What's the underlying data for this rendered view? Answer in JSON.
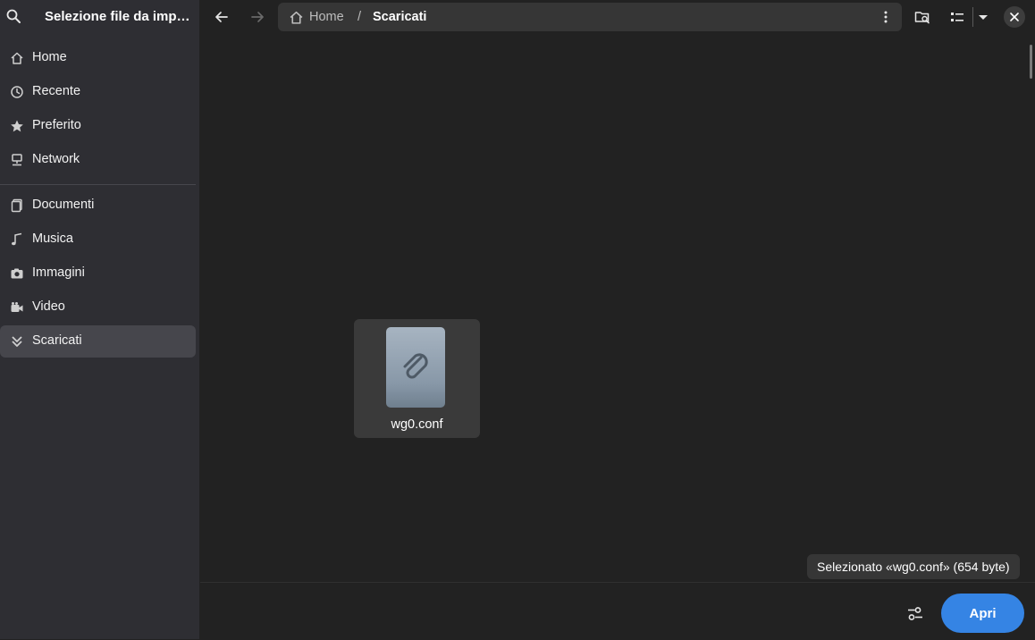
{
  "window": {
    "title": "Selezione file da imp…"
  },
  "sidebar": {
    "places": [
      {
        "label": "Home",
        "icon": "home-icon"
      },
      {
        "label": "Recente",
        "icon": "clock-icon"
      },
      {
        "label": "Preferito",
        "icon": "star-icon"
      },
      {
        "label": "Network",
        "icon": "network-icon"
      }
    ],
    "bookmarks": [
      {
        "label": "Documenti",
        "icon": "document-icon"
      },
      {
        "label": "Musica",
        "icon": "music-icon"
      },
      {
        "label": "Immagini",
        "icon": "camera-icon"
      },
      {
        "label": "Video",
        "icon": "video-icon"
      },
      {
        "label": "Scaricati",
        "icon": "download-icon",
        "selected": true
      }
    ]
  },
  "pathbar": {
    "home": "Home",
    "separator": "/",
    "current": "Scaricati"
  },
  "files": [
    {
      "name": "wg0.conf",
      "icon": "paperclip-icon",
      "selected": true
    }
  ],
  "status": {
    "text": "Selezionato «wg0.conf»  (654 byte)"
  },
  "actions": {
    "open_label": "Apri"
  },
  "colors": {
    "accent": "#3584e4",
    "background": "#222222",
    "sidebar": "#2e2e33"
  }
}
